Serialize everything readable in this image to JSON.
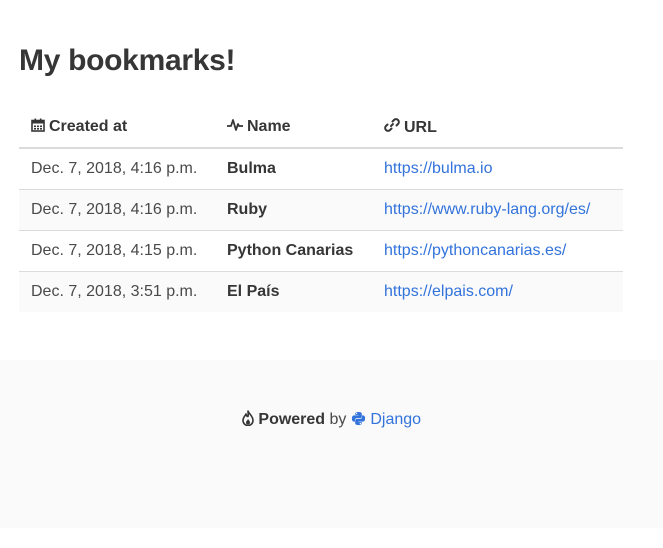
{
  "page": {
    "title": "My bookmarks!"
  },
  "table": {
    "headers": {
      "created": "Created at",
      "name": "Name",
      "url": "URL"
    },
    "header_icons": {
      "created": "calendar-icon",
      "name": "heartbeat-icon",
      "url": "link-icon"
    },
    "rows": [
      {
        "created": "Dec. 7, 2018, 4:16 p.m.",
        "name": "Bulma",
        "url": "https://bulma.io"
      },
      {
        "created": "Dec. 7, 2018, 4:16 p.m.",
        "name": "Ruby",
        "url": "https://www.ruby-lang.org/es/"
      },
      {
        "created": "Dec. 7, 2018, 4:15 p.m.",
        "name": "Python Canarias",
        "url": "https://pythoncanarias.es/"
      },
      {
        "created": "Dec. 7, 2018, 3:51 p.m.",
        "name": "El País",
        "url": "https://elpais.com/"
      }
    ]
  },
  "footer": {
    "powered": "Powered",
    "by": "by",
    "framework": "Django",
    "icons": {
      "powered": "fire-icon",
      "framework": "python-icon"
    }
  },
  "colors": {
    "link": "#3273dc",
    "text": "#363636",
    "footer_bg": "#fafafa",
    "border": "#dbdbdb"
  }
}
